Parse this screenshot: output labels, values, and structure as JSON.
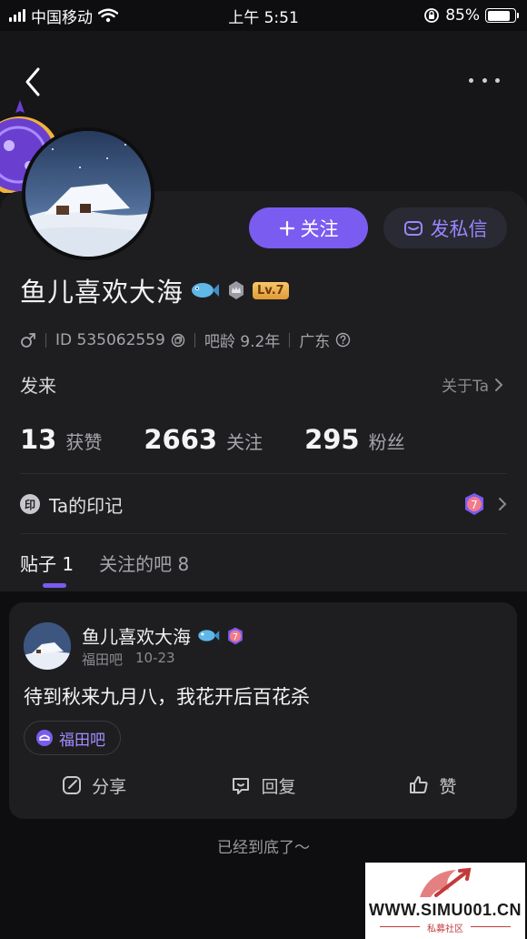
{
  "status_bar": {
    "carrier": "中国移动",
    "time": "上午 5:51",
    "battery_text": "85%",
    "battery_level": 0.85
  },
  "profile": {
    "name": "鱼儿喜欢大海",
    "level_badge": "Lv.7",
    "gender_icon": "male-icon",
    "id_text": "ID 535062559",
    "age_text": "吧龄 9.2年",
    "location": "广东",
    "bio": "发来",
    "about_link": "关于Ta",
    "follow_button": "关注",
    "message_button": "发私信"
  },
  "stats": [
    {
      "value": "13",
      "label": "获赞"
    },
    {
      "value": "2663",
      "label": "关注"
    },
    {
      "value": "295",
      "label": "粉丝"
    }
  ],
  "marks": {
    "label": "Ta的印记",
    "seal_char": "印",
    "badge_number": "7"
  },
  "tabs": [
    {
      "label": "贴子 1",
      "active": true
    },
    {
      "label": "关注的吧 8",
      "active": false
    }
  ],
  "post": {
    "author": "鱼儿喜欢大海",
    "forum_meta": "福田吧",
    "date": "10-23",
    "text": "待到秋来九月八，我花开后百花杀",
    "forum_chip": "福田吧",
    "badge_number": "7",
    "actions": {
      "share": "分享",
      "reply": "回复",
      "like": "赞"
    }
  },
  "end_text": "已经到底了～",
  "watermark": {
    "text": "WWW.SIMU001.CN",
    "sub": "私募社区"
  },
  "colors": {
    "accent": "#7b5cf0",
    "background": "#0e0e10",
    "card": "#1e1e21"
  }
}
